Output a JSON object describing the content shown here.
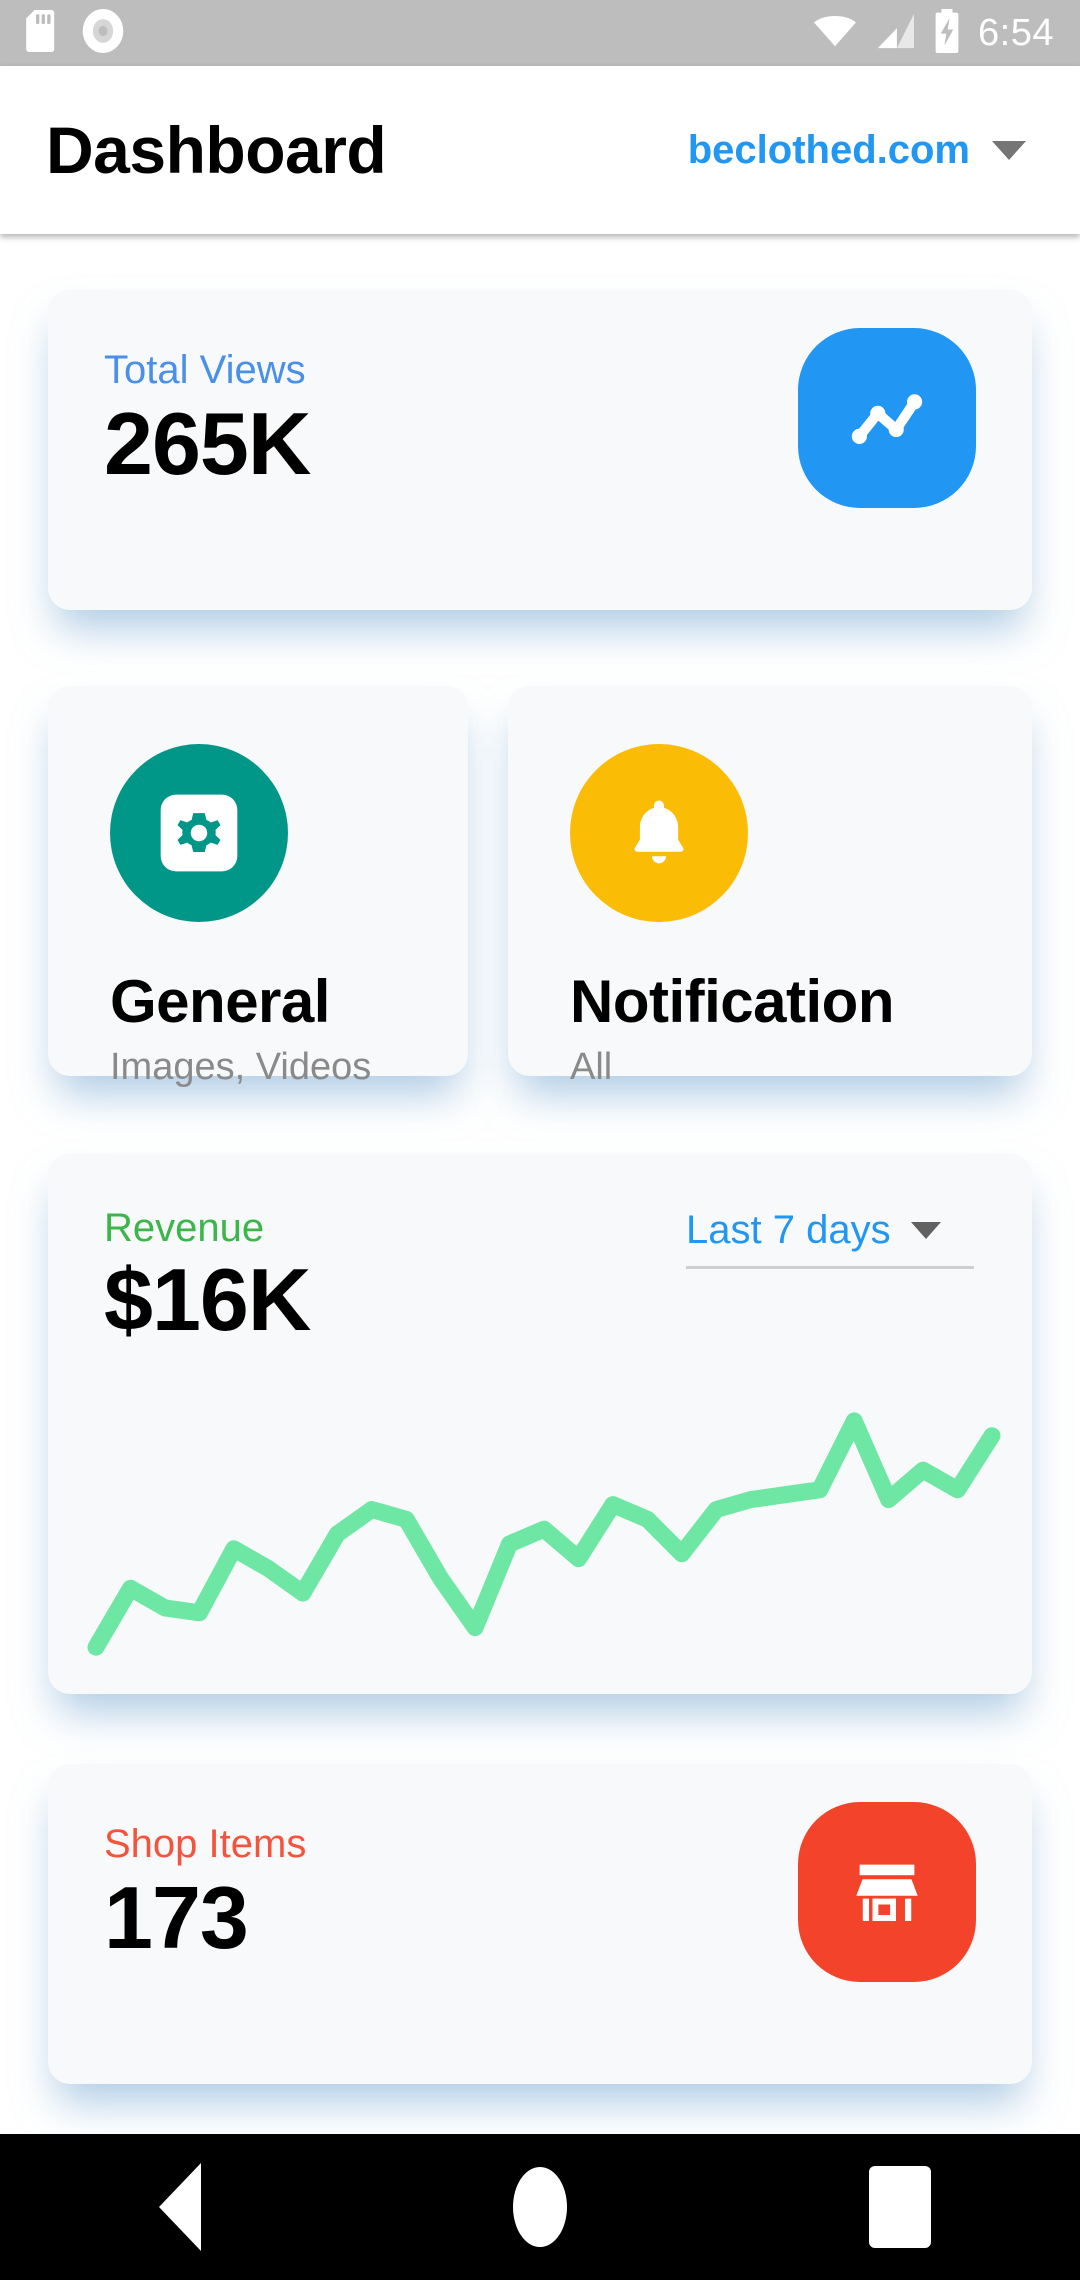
{
  "status_bar": {
    "icons": [
      "sd-card-icon",
      "disc-icon"
    ],
    "wifi_icon": "wifi-icon",
    "signal_icon": "cellular-signal-icon",
    "battery_icon": "battery-charging-icon",
    "time": "6:54"
  },
  "app_bar": {
    "title": "Dashboard",
    "site": "beclothed.com",
    "site_color": "#2196f3",
    "dropdown_icon": "chevron-down-icon"
  },
  "cards": {
    "total_views": {
      "label": "Total Views",
      "value": "265K",
      "label_color": "#4a90e8",
      "icon": "line-chart-icon",
      "icon_bg": "#2196f3"
    },
    "general": {
      "title": "General",
      "subtitle": "Images, Videos",
      "icon": "gear-icon",
      "icon_bg": "#009688"
    },
    "notification": {
      "title": "Notification",
      "subtitle": "All",
      "icon": "bell-icon",
      "icon_bg": "#fbbc05"
    },
    "revenue": {
      "label": "Revenue",
      "value": "$16K",
      "label_color": "#3cb54a",
      "range": "Last 7 days",
      "range_icon": "chevron-down-icon",
      "line_color": "#6ee7a5"
    },
    "shop_items": {
      "label": "Shop Items",
      "value": "173",
      "label_color": "#f4543c",
      "icon": "store-icon",
      "icon_bg": "#f4432b"
    }
  },
  "nav_bar": {
    "back": "back-button",
    "home": "home-button",
    "recents": "recents-button"
  },
  "chart_data": {
    "type": "line",
    "title": "Revenue",
    "subtitle": "$16K",
    "series": [
      {
        "name": "Revenue",
        "color": "#6ee7a5",
        "x": [
          0,
          1,
          2,
          3,
          4,
          5,
          6,
          7,
          8,
          9,
          10,
          11,
          12,
          13,
          14,
          15,
          16,
          17,
          18,
          19,
          20,
          21,
          22,
          23,
          24,
          25,
          26
        ],
        "values": [
          6,
          30,
          22,
          20,
          46,
          38,
          28,
          52,
          62,
          58,
          34,
          14,
          48,
          54,
          42,
          64,
          58,
          44,
          62,
          66,
          68,
          70,
          98,
          66,
          78,
          70,
          92
        ]
      }
    ],
    "xlabel": "",
    "ylabel": "",
    "ylim": [
      0,
      100
    ],
    "grid": false,
    "legend": "none",
    "axis_visible": false
  }
}
